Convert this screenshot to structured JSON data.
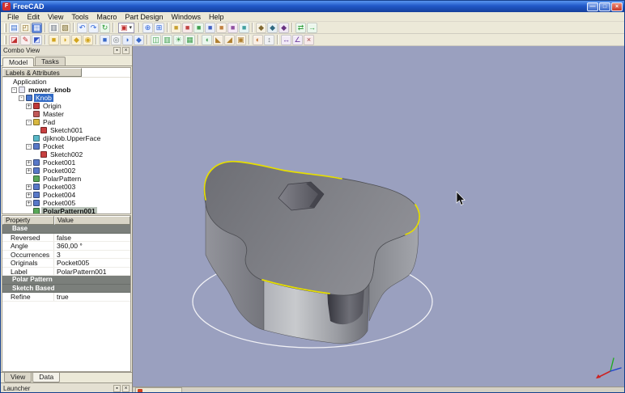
{
  "colors": {
    "viewport_bg": "#9aa0bf",
    "edge_highlight": "#e6de00",
    "selection": "#316ac5",
    "titlebar_blue": "#2158c8"
  },
  "window": {
    "title": "FreeCAD",
    "controls": [
      {
        "name": "minimize-button",
        "glyph": "—"
      },
      {
        "name": "maximize-button",
        "glyph": "□"
      },
      {
        "name": "close-button",
        "glyph": "×",
        "close": true
      }
    ]
  },
  "menu": {
    "items": [
      "File",
      "Edit",
      "View",
      "Tools",
      "Macro",
      "Part Design",
      "Windows",
      "Help"
    ]
  },
  "toolbars": {
    "row1": [
      {
        "name": "new-file-icon",
        "glyph": "▤",
        "fg": "#3a6fd0",
        "bg": "#f4f7fd"
      },
      {
        "name": "open-file-icon",
        "glyph": "◰",
        "fg": "#8a6a20",
        "bg": "#f7f3e2"
      },
      {
        "name": "save-file-icon",
        "glyph": "▦",
        "fg": "#ffffff",
        "bg": "#5a82d8"
      },
      {
        "type": "sep"
      },
      {
        "name": "copy-icon",
        "glyph": "▥",
        "fg": "#667080",
        "bg": "#f4f4f0"
      },
      {
        "name": "paste-icon",
        "glyph": "▧",
        "fg": "#7a6a30",
        "bg": "#f0ead6"
      },
      {
        "type": "sep"
      },
      {
        "name": "undo-icon",
        "glyph": "↶",
        "fg": "#2b62d9",
        "bg": "#edf2fb"
      },
      {
        "name": "redo-icon",
        "glyph": "↷",
        "fg": "#2b62d9",
        "bg": "#edf2fb"
      },
      {
        "name": "refresh-icon",
        "glyph": "↻",
        "fg": "#2e9e3a",
        "bg": "#ebf7ec"
      },
      {
        "type": "sep"
      },
      {
        "type": "combo",
        "name": "workbench-selector",
        "glyph": "▣",
        "fg": "#c03030"
      },
      {
        "type": "sep"
      },
      {
        "name": "zoom-fit-icon",
        "glyph": "⊕",
        "fg": "#2b62d9",
        "bg": "#edf2fb"
      },
      {
        "name": "zoom-region-icon",
        "glyph": "⊞",
        "fg": "#2b62d9",
        "bg": "#edf2fb"
      },
      {
        "type": "sep"
      },
      {
        "name": "view-isometric-icon",
        "glyph": "■",
        "fg": "#c8a030",
        "bg": "#f9f2dd"
      },
      {
        "name": "view-front-icon",
        "glyph": "■",
        "fg": "#c04040",
        "bg": "#f8e9e9"
      },
      {
        "name": "view-top-icon",
        "glyph": "■",
        "fg": "#3fa050",
        "bg": "#e9f6ea"
      },
      {
        "name": "view-right-icon",
        "glyph": "■",
        "fg": "#4060c0",
        "bg": "#e9edf7"
      },
      {
        "name": "view-rear-icon",
        "glyph": "■",
        "fg": "#c08040",
        "bg": "#f8f0e5"
      },
      {
        "name": "view-bottom-icon",
        "glyph": "■",
        "fg": "#9050a0",
        "bg": "#f4eaf6"
      },
      {
        "name": "view-left-icon",
        "glyph": "■",
        "fg": "#40a0a0",
        "bg": "#e7f4f4"
      },
      {
        "type": "sep"
      },
      {
        "name": "view-axonometric-icon",
        "glyph": "◆",
        "fg": "#806830",
        "bg": "#f6f1e2"
      },
      {
        "name": "view-dimetric-icon",
        "glyph": "◆",
        "fg": "#306880",
        "bg": "#e6eff3"
      },
      {
        "name": "view-trimetric-icon",
        "glyph": "◆",
        "fg": "#683080",
        "bg": "#efe7f3"
      },
      {
        "type": "sep"
      },
      {
        "name": "sync-view-icon",
        "glyph": "⇄",
        "fg": "#2e9e3a",
        "bg": "#ebf7ec"
      },
      {
        "name": "link-select-icon",
        "glyph": "→",
        "fg": "#2e9e3a",
        "bg": "#ebf7ec"
      }
    ],
    "row2": [
      {
        "name": "create-sketch-icon",
        "glyph": "◪",
        "fg": "#c03030",
        "bg": "#f8e7e7"
      },
      {
        "name": "edit-sketch-icon",
        "glyph": "✎",
        "fg": "#c03030",
        "bg": "#f9efef"
      },
      {
        "name": "map-sketch-icon",
        "glyph": "◩",
        "fg": "#3050c0",
        "bg": "#e9edf8"
      },
      {
        "type": "sep"
      },
      {
        "name": "pad-icon",
        "glyph": "■",
        "fg": "#d2a41e",
        "bg": "#faf0d2"
      },
      {
        "name": "revolution-icon",
        "glyph": "◗",
        "fg": "#d2a41e",
        "bg": "#faf0d2"
      },
      {
        "name": "additive-loft-icon",
        "glyph": "◆",
        "fg": "#d2a41e",
        "bg": "#faf0d2"
      },
      {
        "name": "additive-pipe-icon",
        "glyph": "◉",
        "fg": "#d2a41e",
        "bg": "#faf0d2"
      },
      {
        "type": "sep"
      },
      {
        "name": "pocket-icon",
        "glyph": "■",
        "fg": "#3868c8",
        "bg": "#e7edf9"
      },
      {
        "name": "hole-icon",
        "glyph": "◎",
        "fg": "#707880",
        "bg": "#f0f1f3"
      },
      {
        "name": "groove-icon",
        "glyph": "◗",
        "fg": "#3868c8",
        "bg": "#e7edf9"
      },
      {
        "name": "subtractive-loft-icon",
        "glyph": "◆",
        "fg": "#3868c8",
        "bg": "#e7edf9"
      },
      {
        "type": "sep"
      },
      {
        "name": "mirrored-icon",
        "glyph": "◫",
        "fg": "#3f9e4e",
        "bg": "#eaf6ec"
      },
      {
        "name": "linear-pattern-icon",
        "glyph": "▥",
        "fg": "#3f9e4e",
        "bg": "#eaf6ec"
      },
      {
        "name": "polar-pattern-icon",
        "glyph": "☀",
        "fg": "#3f9e4e",
        "bg": "#eaf6ec"
      },
      {
        "name": "multitransform-icon",
        "glyph": "▦",
        "fg": "#3f9e4e",
        "bg": "#eaf6ec"
      },
      {
        "type": "sep"
      },
      {
        "name": "fillet-icon",
        "glyph": "◖",
        "fg": "#4aa05a",
        "bg": "#ebf6ed"
      },
      {
        "name": "chamfer-icon",
        "glyph": "◣",
        "fg": "#b08030",
        "bg": "#f7f0e2"
      },
      {
        "name": "draft-icon",
        "glyph": "◢",
        "fg": "#b08030",
        "bg": "#f7f0e2"
      },
      {
        "name": "thickness-icon",
        "glyph": "▣",
        "fg": "#b08030",
        "bg": "#f7f0e2"
      },
      {
        "type": "sep"
      },
      {
        "name": "boolean-icon",
        "glyph": "◐",
        "fg": "#c07030",
        "bg": "#f8efe4"
      },
      {
        "name": "migrate-icon",
        "glyph": "↕",
        "fg": "#707880",
        "bg": "#f0f1f3"
      },
      {
        "type": "sep"
      },
      {
        "name": "measure-linear-icon",
        "glyph": "↔",
        "fg": "#7040a0",
        "bg": "#f1eaf6"
      },
      {
        "name": "measure-angle-icon",
        "glyph": "∠",
        "fg": "#7040a0",
        "bg": "#f1eaf6"
      },
      {
        "name": "clear-measurement-icon",
        "glyph": "×",
        "fg": "#a04040",
        "bg": "#f6eaea"
      }
    ]
  },
  "combo_view": {
    "title": "Combo View",
    "tabs": [
      {
        "label": "Model",
        "active": true
      },
      {
        "label": "Tasks",
        "active": false
      }
    ],
    "tree_header": "Labels & Attributes",
    "tree": [
      {
        "label": "Application",
        "indent": 0
      },
      {
        "label": "mower_knob",
        "indent": 1,
        "expander": "-",
        "icon": "document-icon",
        "icon_color": "#e8e8f4",
        "state": "bold"
      },
      {
        "label": "Knob",
        "indent": 2,
        "expander": "-",
        "icon": "body-icon",
        "icon_color": "#4a78d0",
        "state": "active"
      },
      {
        "label": "Origin",
        "indent": 3,
        "expander": "+",
        "icon": "origin-icon",
        "icon_color": "#c03838"
      },
      {
        "label": "Master",
        "indent": 3,
        "icon": "master-icon",
        "icon_color": "#c05858"
      },
      {
        "label": "Pad",
        "indent": 3,
        "expander": "-",
        "icon": "pad-icon",
        "icon_color": "#d8b840"
      },
      {
        "label": "Sketch001",
        "indent": 4,
        "icon": "sketch-icon",
        "icon_color": "#c84040"
      },
      {
        "label": "djiknob.UpperFace",
        "indent": 3,
        "icon": "face-icon",
        "icon_color": "#58b8c8"
      },
      {
        "label": "Pocket",
        "indent": 3,
        "expander": "-",
        "icon": "pocket-icon",
        "icon_color": "#5878c8"
      },
      {
        "label": "Sketch002",
        "indent": 4,
        "icon": "sketch-icon",
        "icon_color": "#c84040"
      },
      {
        "label": "Pocket001",
        "indent": 3,
        "expander": "+",
        "icon": "pocket-icon",
        "icon_color": "#5878c8"
      },
      {
        "label": "Pocket002",
        "indent": 3,
        "expander": "+",
        "icon": "pocket-icon",
        "icon_color": "#5878c8"
      },
      {
        "label": "PolarPattern",
        "indent": 3,
        "icon": "pattern-icon",
        "icon_color": "#58a858"
      },
      {
        "label": "Pocket003",
        "indent": 3,
        "expander": "+",
        "icon": "pocket-icon",
        "icon_color": "#5878c8"
      },
      {
        "label": "Pocket004",
        "indent": 3,
        "expander": "+",
        "icon": "pocket-icon",
        "icon_color": "#5878c8"
      },
      {
        "label": "Pocket005",
        "indent": 3,
        "expander": "+",
        "icon": "pocket-icon",
        "icon_color": "#5878c8"
      },
      {
        "label": "PolarPattern001",
        "indent": 3,
        "icon": "pattern-icon",
        "icon_color": "#58a858",
        "state": "selected"
      }
    ],
    "properties": {
      "columns": [
        "Property",
        "Value"
      ],
      "rows": [
        {
          "type": "section",
          "label": "Base"
        },
        {
          "type": "row",
          "property": "Reversed",
          "value": "false"
        },
        {
          "type": "row",
          "property": "Angle",
          "value": "360,00 °"
        },
        {
          "type": "row",
          "property": "Occurrences",
          "value": "3"
        },
        {
          "type": "row",
          "property": "Originals",
          "value": "Pocket005"
        },
        {
          "type": "row",
          "property": "Label",
          "value": "PolarPattern001"
        },
        {
          "type": "section",
          "label": "Polar Pattern"
        },
        {
          "type": "section",
          "label": "Sketch Based"
        },
        {
          "type": "row",
          "property": "Refine",
          "value": "true"
        }
      ]
    },
    "bottom_tabs": [
      {
        "label": "View",
        "active": false
      },
      {
        "label": "Data",
        "active": true
      }
    ]
  },
  "launcher": {
    "title": "Launcher"
  }
}
